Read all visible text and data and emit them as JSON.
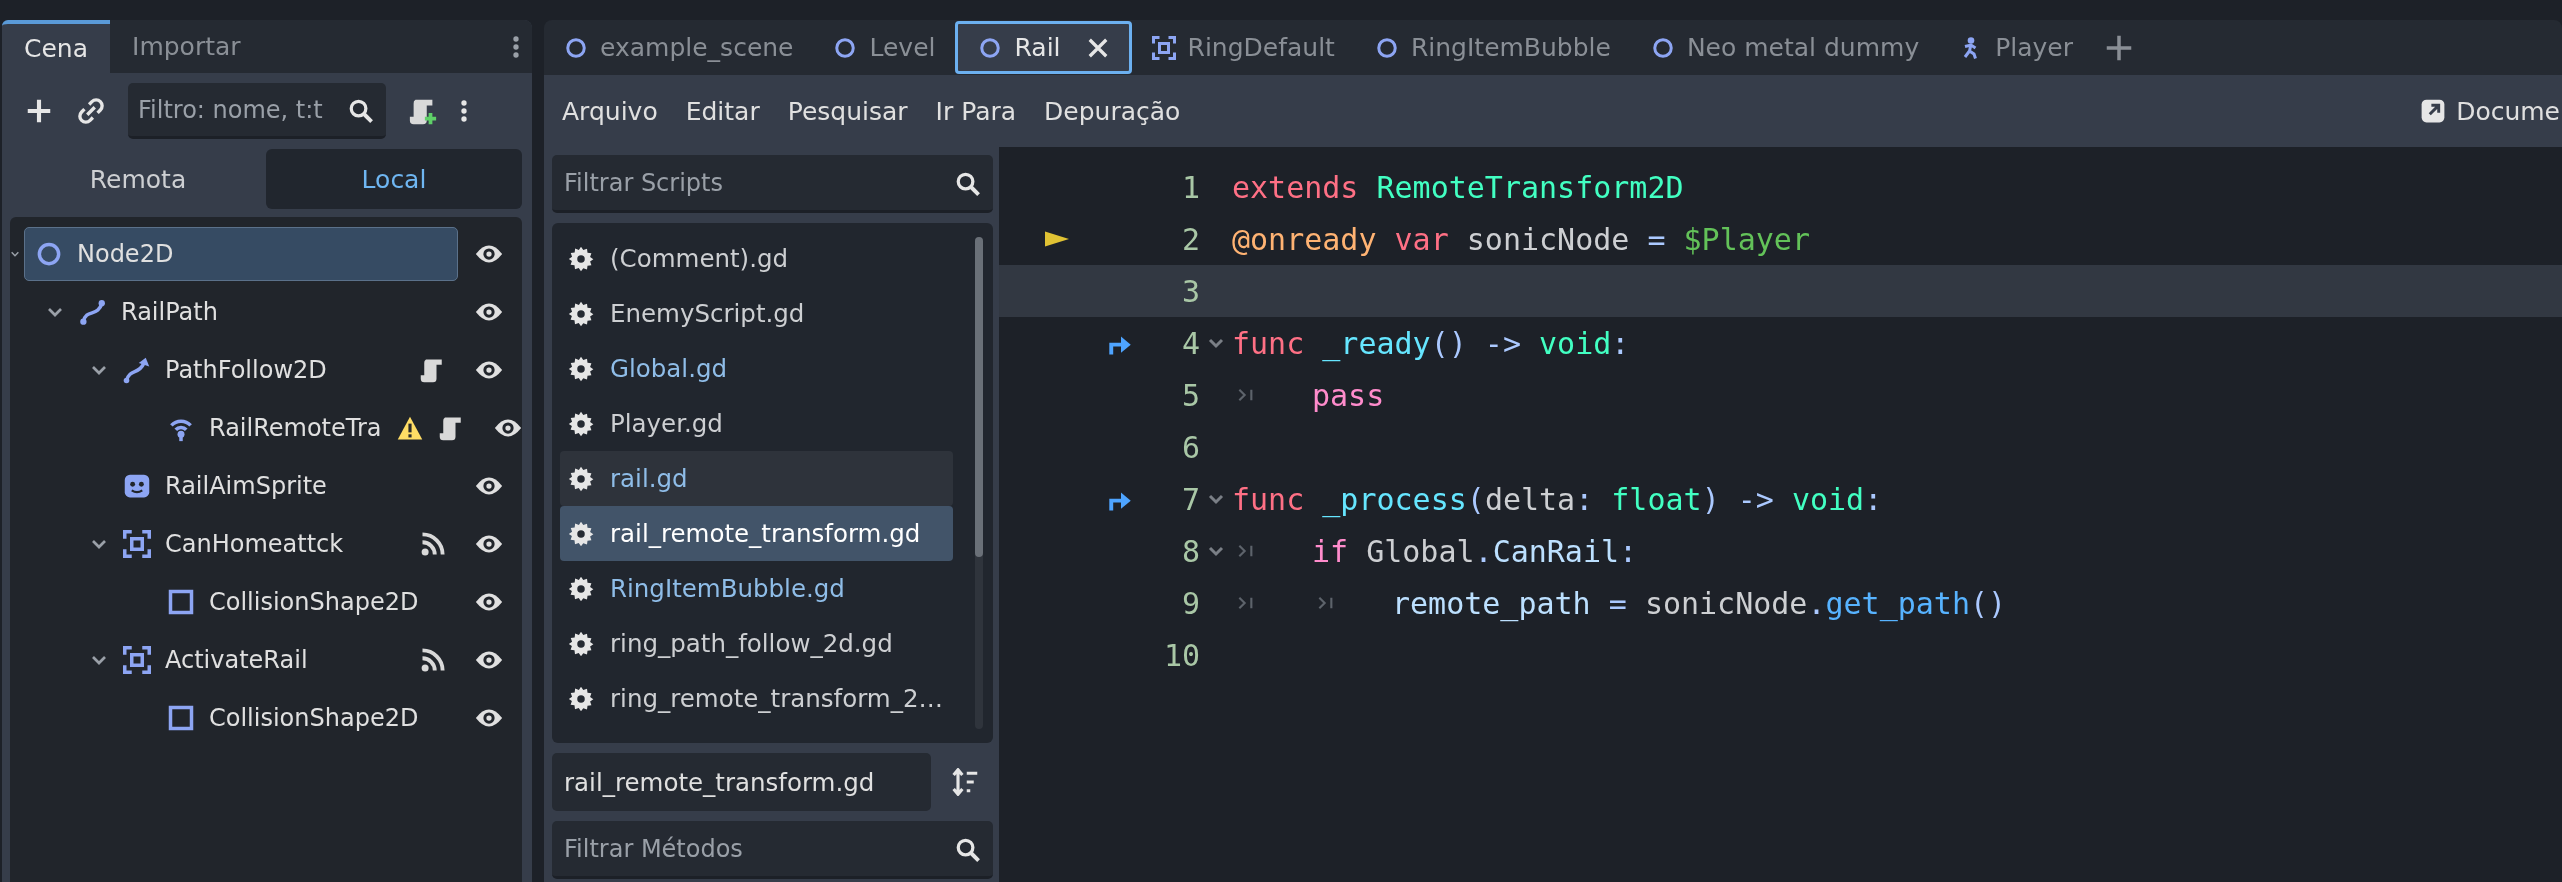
{
  "dock": {
    "tabs": [
      {
        "label": "Cena",
        "selected": true
      },
      {
        "label": "Importar",
        "selected": false
      }
    ],
    "filter": {
      "placeholder": "Filtro: nome, t:t"
    },
    "mode_tabs": [
      {
        "label": "Remota",
        "selected": false
      },
      {
        "label": "Local",
        "selected": true
      }
    ],
    "tree": [
      {
        "name": "Node2D",
        "kind": "node2d",
        "selected": true,
        "expanded": true,
        "script": false,
        "warning": false,
        "signals": false,
        "children": [
          {
            "name": "RailPath",
            "kind": "path",
            "selected": false,
            "expanded": true,
            "script": false,
            "warning": false,
            "signals": false,
            "children": [
              {
                "name": "PathFollow2D",
                "kind": "pathfollow",
                "selected": false,
                "expanded": true,
                "script": true,
                "warning": false,
                "signals": false,
                "children": [
                  {
                    "name": "RailRemoteTra",
                    "kind": "remote",
                    "selected": false,
                    "script": true,
                    "warning": true,
                    "signals": false
                  }
                ]
              },
              {
                "name": "RailAimSprite",
                "kind": "sprite",
                "selected": false,
                "script": false,
                "warning": false,
                "signals": false
              },
              {
                "name": "CanHomeattck",
                "kind": "area",
                "selected": false,
                "expanded": true,
                "script": false,
                "warning": false,
                "signals": true,
                "children": [
                  {
                    "name": "CollisionShape2D",
                    "kind": "shape",
                    "selected": false,
                    "script": false,
                    "warning": false,
                    "signals": false
                  }
                ]
              },
              {
                "name": "ActivateRail",
                "kind": "area",
                "selected": false,
                "expanded": true,
                "script": false,
                "warning": false,
                "signals": true,
                "children": [
                  {
                    "name": "CollisionShape2D",
                    "kind": "shape",
                    "selected": false,
                    "script": false,
                    "warning": false,
                    "signals": false
                  }
                ]
              }
            ]
          }
        ]
      }
    ]
  },
  "scene_tabs": [
    {
      "label": "example_scene",
      "kind": "node2d",
      "selected": false
    },
    {
      "label": "Level",
      "kind": "node2d",
      "selected": false
    },
    {
      "label": "Rail",
      "kind": "node2d",
      "selected": true
    },
    {
      "label": "RingDefault",
      "kind": "area",
      "selected": false
    },
    {
      "label": "RingItemBubble",
      "kind": "node2d",
      "selected": false
    },
    {
      "label": "Neo metal dummy",
      "kind": "node2d",
      "selected": false
    },
    {
      "label": "Player",
      "kind": "character",
      "selected": false
    }
  ],
  "menu": [
    "Arquivo",
    "Editar",
    "Pesquisar",
    "Ir Para",
    "Depuração"
  ],
  "docs_link": "Docume",
  "script_panel": {
    "filter": {
      "placeholder": "Filtrar Scripts"
    },
    "scripts": [
      {
        "name": "(Comment).gd",
        "color": "#cdcfd2",
        "selected": false,
        "hovered": false
      },
      {
        "name": "EnemyScript.gd",
        "color": "#cdcfd2",
        "selected": false,
        "hovered": false
      },
      {
        "name": "Global.gd",
        "color": "#8fbde8",
        "selected": false,
        "hovered": false
      },
      {
        "name": "Player.gd",
        "color": "#cdcfd2",
        "selected": false,
        "hovered": false
      },
      {
        "name": "rail.gd",
        "color": "#8fbde8",
        "selected": false,
        "hovered": true
      },
      {
        "name": "rail_remote_transform.gd",
        "color": "#ffffff",
        "selected": true,
        "hovered": false
      },
      {
        "name": "RingItemBubble.gd",
        "color": "#8fbde8",
        "selected": false,
        "hovered": false
      },
      {
        "name": "ring_path_follow_2d.gd",
        "color": "#cdcfd2",
        "selected": false,
        "hovered": false
      },
      {
        "name": "ring_remote_transform_2…",
        "color": "#cdcfd2",
        "selected": false,
        "hovered": false
      }
    ],
    "current_script": "rail_remote_transform.gd",
    "methods_filter": {
      "placeholder": "Filtrar Métodos"
    }
  },
  "code": [
    {
      "number": "1",
      "pointer": false,
      "override": false,
      "foldable": false,
      "current": false,
      "tokens": [
        {
          "kind": "keyword",
          "text": "extends "
        },
        {
          "kind": "type",
          "text": "RemoteTransform2D"
        }
      ]
    },
    {
      "number": "2",
      "pointer": true,
      "override": false,
      "foldable": false,
      "current": false,
      "tokens": [
        {
          "kind": "annotation",
          "text": "@onready "
        },
        {
          "kind": "keyword",
          "text": "var "
        },
        {
          "kind": "text",
          "text": "sonicNode "
        },
        {
          "kind": "symbol",
          "text": "= "
        },
        {
          "kind": "nodepath",
          "text": "$Player"
        }
      ]
    },
    {
      "number": "3",
      "pointer": false,
      "override": false,
      "foldable": false,
      "current": true
    },
    {
      "number": "4",
      "pointer": false,
      "override": true,
      "foldable": true,
      "current": false,
      "tokens": [
        {
          "kind": "keyword",
          "text": "func "
        },
        {
          "kind": "function",
          "text": "_ready"
        },
        {
          "kind": "symbol",
          "text": "() -> "
        },
        {
          "kind": "type",
          "text": "void"
        },
        {
          "kind": "symbol",
          "text": ":"
        }
      ]
    },
    {
      "number": "5",
      "pointer": false,
      "override": false,
      "foldable": false,
      "current": false,
      "tokens": [
        {
          "kind": "tab"
        },
        {
          "kind": "control",
          "text": "pass"
        }
      ]
    },
    {
      "number": "6",
      "pointer": false,
      "override": false,
      "foldable": false,
      "current": false
    },
    {
      "number": "7",
      "pointer": false,
      "override": true,
      "foldable": true,
      "current": false,
      "tokens": [
        {
          "kind": "keyword",
          "text": "func "
        },
        {
          "kind": "function",
          "text": "_process"
        },
        {
          "kind": "symbol",
          "text": "("
        },
        {
          "kind": "text",
          "text": "delta"
        },
        {
          "kind": "symbol",
          "text": ": "
        },
        {
          "kind": "type",
          "text": "float"
        },
        {
          "kind": "symbol",
          "text": ") -> "
        },
        {
          "kind": "type",
          "text": "void"
        },
        {
          "kind": "symbol",
          "text": ":"
        }
      ]
    },
    {
      "number": "8",
      "pointer": false,
      "override": false,
      "foldable": true,
      "current": false,
      "tokens": [
        {
          "kind": "tab"
        },
        {
          "kind": "control",
          "text": "if "
        },
        {
          "kind": "text",
          "text": "Global"
        },
        {
          "kind": "symbol",
          "text": "."
        },
        {
          "kind": "member",
          "text": "CanRail"
        },
        {
          "kind": "symbol",
          "text": ":"
        }
      ]
    },
    {
      "number": "9",
      "pointer": false,
      "override": false,
      "foldable": false,
      "current": false,
      "tokens": [
        {
          "kind": "tab"
        },
        {
          "kind": "tab"
        },
        {
          "kind": "member",
          "text": "remote_path "
        },
        {
          "kind": "symbol",
          "text": "= "
        },
        {
          "kind": "text",
          "text": "sonicNode"
        },
        {
          "kind": "symbol",
          "text": "."
        },
        {
          "kind": "method",
          "text": "get_path"
        },
        {
          "kind": "symbol",
          "text": "()"
        }
      ]
    },
    {
      "number": "10",
      "pointer": false,
      "override": false,
      "foldable": false,
      "current": false
    }
  ]
}
